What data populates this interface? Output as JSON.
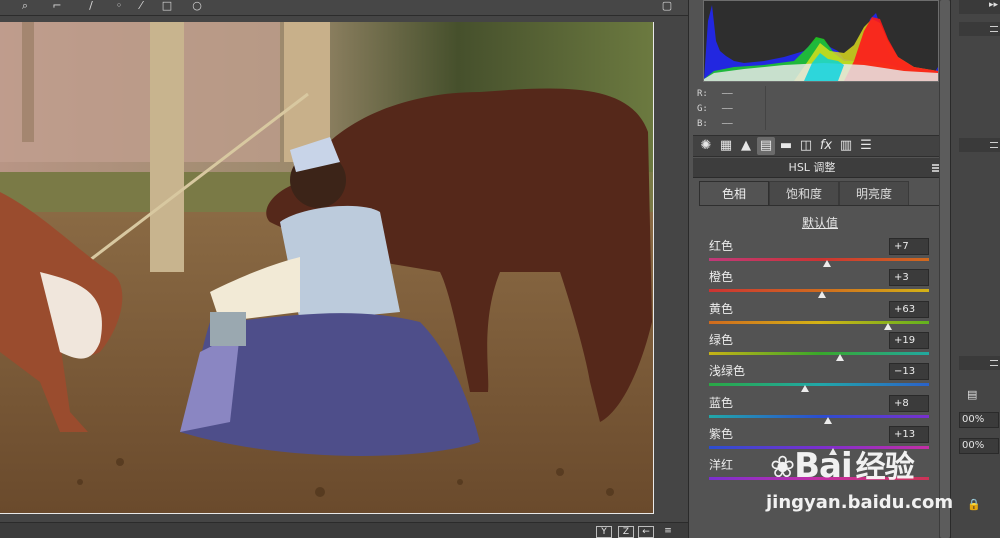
{
  "toolbar": {
    "icons": [
      "zoom-icon",
      "crop-icon",
      "brush-icon",
      "redeye-icon",
      "eyedropper-icon",
      "rect-icon",
      "rotate-icon"
    ]
  },
  "histogram": {
    "readout": [
      {
        "label": "R:",
        "value": "——"
      },
      {
        "label": "G:",
        "value": "——"
      },
      {
        "label": "B:",
        "value": "——"
      }
    ]
  },
  "panel_icons": [
    "aperture-icon",
    "grid-icon",
    "mountain-icon",
    "hsl-icon",
    "split-tone-icon",
    "detail-icon",
    "fx-icon",
    "camera-calibration-icon",
    "presets-icon"
  ],
  "panel": {
    "title": "HSL 调整",
    "tabs": [
      "色相",
      "饱和度",
      "明亮度"
    ],
    "active_tab": 0,
    "default_label": "默认值"
  },
  "sliders": [
    {
      "label": "红色",
      "value": "+7",
      "fraction": 0.535,
      "gradient": "linear-gradient(90deg,#c0397a,#cc3333,#d06a1e)"
    },
    {
      "label": "橙色",
      "value": "+3",
      "fraction": 0.515,
      "gradient": "linear-gradient(90deg,#cc3333,#d06a1e,#d4b316)"
    },
    {
      "label": "黄色",
      "value": "+63",
      "fraction": 0.815,
      "gradient": "linear-gradient(90deg,#d06a1e,#d4b316,#62b21e)"
    },
    {
      "label": "绿色",
      "value": "+19",
      "fraction": 0.595,
      "gradient": "linear-gradient(90deg,#c7b316,#39a82a,#21a8a0)"
    },
    {
      "label": "浅绿色",
      "value": "−13",
      "fraction": 0.435,
      "gradient": "linear-gradient(90deg,#2aa844,#21a8a8,#2b62c9)"
    },
    {
      "label": "蓝色",
      "value": "+8",
      "fraction": 0.54,
      "gradient": "linear-gradient(90deg,#21a8a8,#2b4ecf,#7a2fcf)"
    },
    {
      "label": "紫色",
      "value": "+13",
      "fraction": 0.565,
      "gradient": "linear-gradient(90deg,#2b4ecf,#7a2fcf,#c42fa6)"
    },
    {
      "label": "洋红",
      "value": "",
      "fraction": 0.5,
      "gradient": "linear-gradient(90deg,#7a2fcf,#c42fa6,#cc3355)"
    }
  ],
  "dock": {
    "zoom_values": [
      "00%",
      "00%"
    ]
  },
  "bottom_buttons": [
    "Y",
    "Z",
    "←",
    "≡"
  ],
  "watermark": {
    "logo": "Bai",
    "logo_cn": "经验",
    "url": "jingyan.baidu.com"
  }
}
